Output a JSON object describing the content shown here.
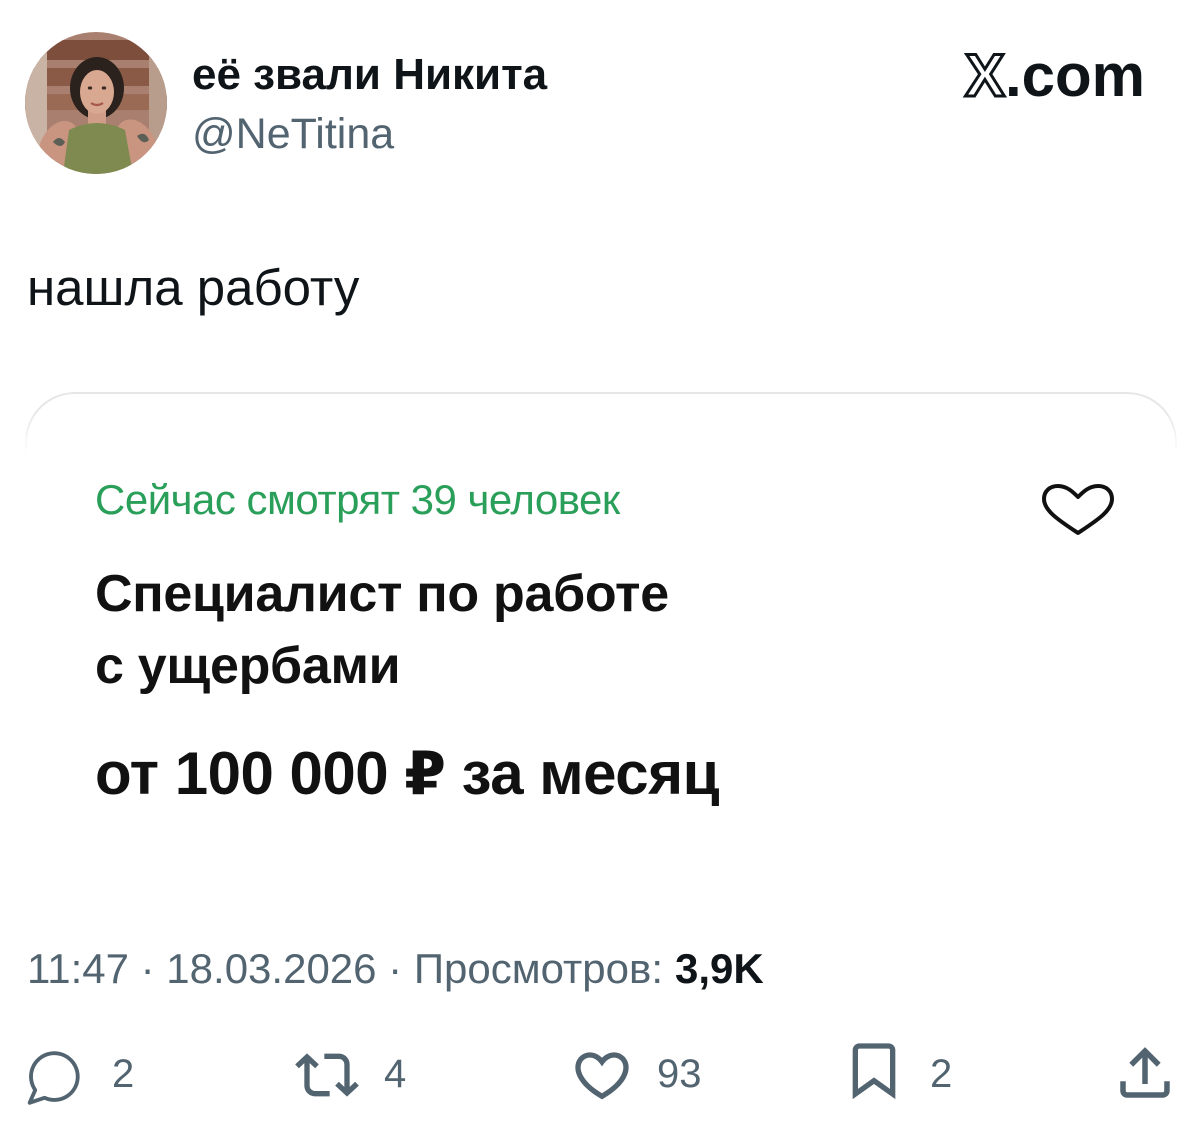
{
  "tweet": {
    "author": {
      "display_name": "её звали Никита",
      "handle": "@NeTitina",
      "avatar_icon": "avatar-photo-icon"
    },
    "brand": {
      "logo_mark": "X",
      "logo_suffix": ".com"
    },
    "text": "нашла работу",
    "media_card": {
      "viewers_text": "Сейчас смотрят 39 человек",
      "title_lines": [
        "Специалист по работе",
        "с ущербами"
      ],
      "salary": "от 100 000 ₽ за месяц",
      "favorite_icon": "heart-outline-icon"
    },
    "meta": {
      "timestamp_text": "11:47 · 18.03.2026 · Просмотров:",
      "views_count": "3,9K"
    },
    "actions": [
      {
        "name": "reply",
        "icon": "reply-icon",
        "count": "2"
      },
      {
        "name": "retweet",
        "icon": "retweet-icon",
        "count": "4"
      },
      {
        "name": "like",
        "icon": "heart-icon",
        "count": "93"
      },
      {
        "name": "bookmark",
        "icon": "bookmark-icon",
        "count": "2"
      },
      {
        "name": "share",
        "icon": "share-icon"
      }
    ]
  },
  "colors": {
    "text": "#0f1419",
    "secondary": "#536471",
    "accent_green": "#2a9f5a",
    "card_border": "#e4e6e8"
  }
}
